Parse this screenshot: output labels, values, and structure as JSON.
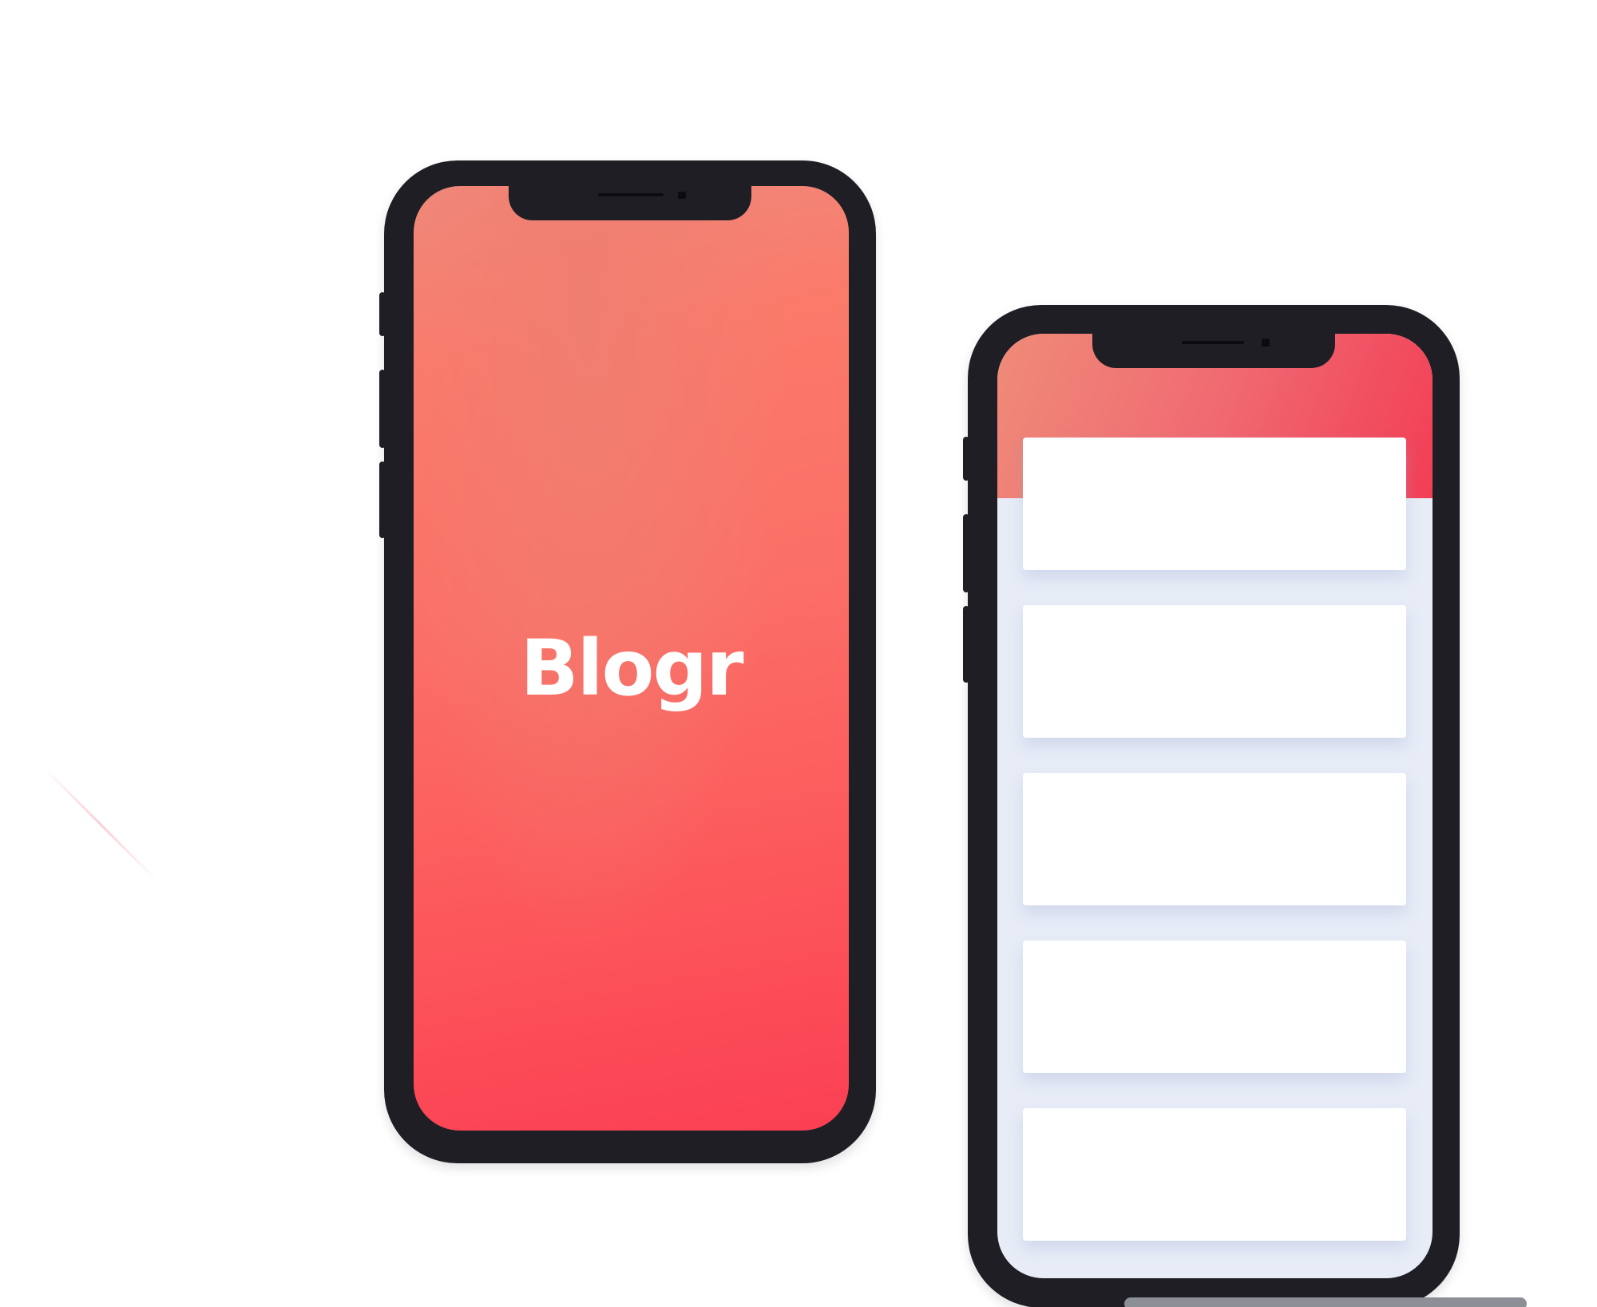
{
  "app": {
    "brand_name": "Blogr"
  },
  "phones": [
    {
      "id": "splash",
      "screen": {
        "logo_text": "Blogr",
        "gradient_colors": [
          "#ee8a7c",
          "#fb6f66",
          "#fb3f53"
        ]
      }
    },
    {
      "id": "feed",
      "screen": {
        "header_gradient": [
          "#ef8b78",
          "#f23e56"
        ],
        "background": "#e7ecf7",
        "cards": [
          {
            "type": "placeholder"
          },
          {
            "type": "placeholder"
          },
          {
            "type": "placeholder"
          },
          {
            "type": "placeholder"
          },
          {
            "type": "placeholder"
          }
        ]
      }
    }
  ],
  "colors": {
    "phone_body": "#1e1e24",
    "card_bg": "#ffffff",
    "accent": "#f23e56"
  }
}
